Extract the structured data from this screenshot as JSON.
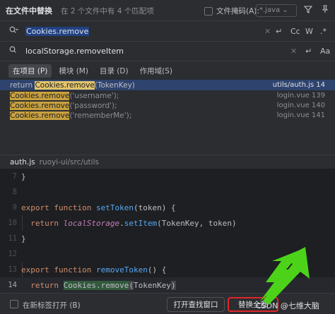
{
  "header": {
    "title": "在文件中替换",
    "summary": "在 2 个文件中有 4 个匹配项",
    "file_mask_label": "文件掩码(A):",
    "file_mask_value": "*.java",
    "filter_icon": "filter-icon",
    "pin_icon": "pin-icon"
  },
  "search": {
    "query": "Cookies.remove",
    "icon": "search-icon"
  },
  "replace": {
    "value": "localStorage.removeItem",
    "icon": "replace-icon"
  },
  "toolbar": {
    "case_label": "Cc",
    "word_label": "W",
    "regex_label": ".*"
  },
  "scope_tabs": [
    {
      "label": "在项目 (P)",
      "active": true
    },
    {
      "label": "模块 (M)",
      "active": false
    },
    {
      "label": "目录 (D)",
      "active": false
    },
    {
      "label": "作用域(S)",
      "active": false
    }
  ],
  "results": [
    {
      "prefix": "return ",
      "match": "Cookies.remove",
      "suffix": "(TokenKey)",
      "location": "utils/auth.js 14",
      "selected": true
    },
    {
      "prefix": "",
      "match": "Cookies.remove",
      "suffix": "('username');",
      "location": "login.vue 139",
      "selected": false
    },
    {
      "prefix": "",
      "match": "Cookies.remove",
      "suffix": "('password');",
      "location": "login.vue 140",
      "selected": false
    },
    {
      "prefix": "",
      "match": "Cookies.remove",
      "suffix": "('rememberMe');",
      "location": "login.vue 141",
      "selected": false
    }
  ],
  "file": {
    "name": "auth.js",
    "path": "ruoyi-ui/src/utils"
  },
  "code": [
    {
      "num": "7",
      "text": "}"
    },
    {
      "num": "8",
      "text": ""
    },
    {
      "num": "9",
      "text": "export function setToken(token) {"
    },
    {
      "num": "10",
      "text": "  return localStorage.setItem(TokenKey, token)"
    },
    {
      "num": "11",
      "text": "}"
    },
    {
      "num": "12",
      "text": ""
    },
    {
      "num": "13",
      "text": "export function removeToken() {"
    },
    {
      "num": "14",
      "text": "  return Cookies.remove(TokenKey)"
    }
  ],
  "footer": {
    "new_tab_label": "在新标签打开 (B)",
    "open_find_window": "打开查找窗口",
    "replace_all": "替换全部",
    "watermark": "CSDN @七维大脑"
  },
  "colors": {
    "accent_red": "#e0262a",
    "arrow_green": "#4cd319",
    "selection": "#2e436e"
  }
}
